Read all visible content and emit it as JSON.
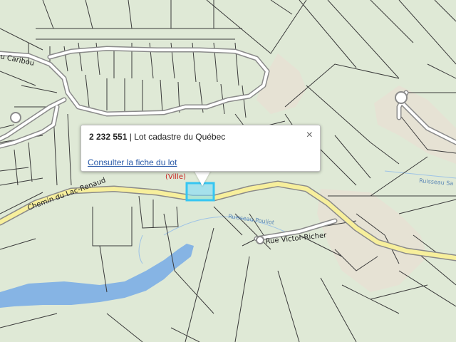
{
  "map": {
    "labels": {
      "road_caribou": "u Caribou",
      "road_lac_renaud": "Chemin du Lac-Renaud",
      "road_victor_richer": "Rue Victor-Richer",
      "stream_1": "Ruisseau Pouliot",
      "stream_2": "Ruisseau Sa",
      "ville_label": "(Ville)"
    },
    "colors": {
      "background": "#dfe9d6",
      "main_road": "#f7ef9c",
      "road_outline": "#8a8a8a",
      "water": "#86b4e4",
      "lot_lines": "#3a3a3a",
      "selected_lot": "#36c6f2",
      "ville_label": "#c81e1e"
    }
  },
  "popup": {
    "lot_number": "2 232 551",
    "separator": " | ",
    "lot_type": "Lot cadastre du Québec",
    "close_icon": "×",
    "link_label": "Consulter la fiche du lot"
  }
}
